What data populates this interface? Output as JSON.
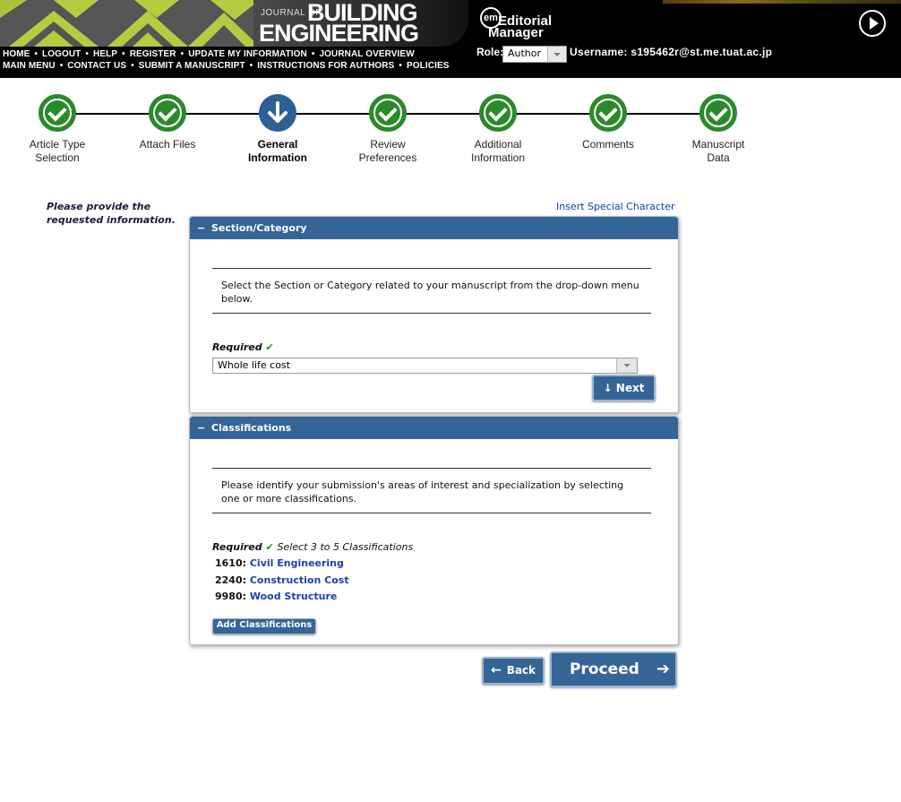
{
  "header": {
    "journal_small": "JOURNAL OF",
    "journal_line1": "BUILDING",
    "journal_line2": "ENGINEERING",
    "em_mark": "em",
    "em_line1": "Editorial",
    "em_line2": "Manager",
    "nav_row1": [
      "HOME",
      "LOGOUT",
      "HELP",
      "REGISTER",
      "UPDATE MY INFORMATION",
      "JOURNAL OVERVIEW"
    ],
    "nav_row2": [
      "MAIN MENU",
      "CONTACT US",
      "SUBMIT A MANUSCRIPT",
      "INSTRUCTIONS FOR AUTHORS",
      "POLICIES"
    ],
    "role_label": "Role:",
    "role_value": "Author",
    "username": "Username: s195462r@st.me.tuat.ac.jp"
  },
  "steps": [
    {
      "line1": "Article Type",
      "line2": "Selection",
      "state": "done"
    },
    {
      "line1": "Attach Files",
      "line2": "",
      "state": "done"
    },
    {
      "line1": "General",
      "line2": "Information",
      "state": "current"
    },
    {
      "line1": "Review",
      "line2": "Preferences",
      "state": "done"
    },
    {
      "line1": "Additional",
      "line2": "Information",
      "state": "done"
    },
    {
      "line1": "Comments",
      "line2": "",
      "state": "done"
    },
    {
      "line1": "Manuscript",
      "line2": "Data",
      "state": "done"
    }
  ],
  "side_note": {
    "line1": "Please provide the",
    "line2": "requested information."
  },
  "special_char_link": "Insert Special Character",
  "section": {
    "title": "Section/Category",
    "toggle": "−",
    "instruction": "Select the Section or Category related to your manuscript from the drop-down menu below.",
    "required_label": "Required",
    "check": "✔",
    "selected": "Whole life cost",
    "next_label": "Next",
    "next_icon": "↓"
  },
  "classifications": {
    "title": "Classifications",
    "toggle": "−",
    "instruction": "Please identify your submission's areas of interest and specialization by selecting one or more classifications.",
    "required_label": "Required",
    "check": "✔",
    "hint": "Select 3 to 5 Classifications",
    "items": [
      {
        "code": "1610:",
        "name": "Civil Engineering"
      },
      {
        "code": "2240:",
        "name": "Construction Cost"
      },
      {
        "code": "9980:",
        "name": "Wood Structure"
      }
    ],
    "add_label": "Add Classifications"
  },
  "footer_buttons": {
    "back_label": "Back",
    "back_icon": "←",
    "proceed_label": "Proceed",
    "proceed_icon": "➔"
  }
}
